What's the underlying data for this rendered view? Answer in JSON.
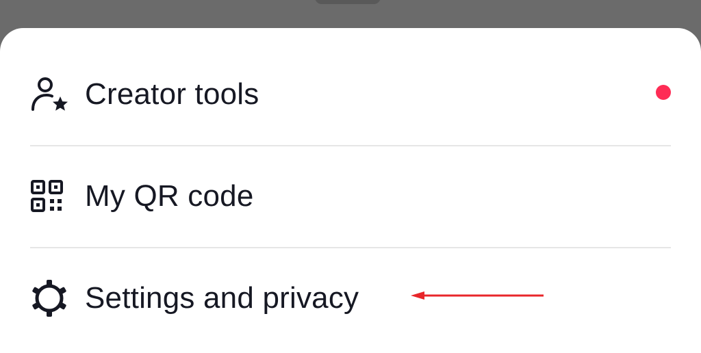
{
  "menu": {
    "items": [
      {
        "label": "Creator tools",
        "icon": "person-star-icon",
        "has_notification": true
      },
      {
        "label": "My QR code",
        "icon": "qr-code-icon"
      },
      {
        "label": "Settings and privacy",
        "icon": "gear-icon"
      }
    ]
  },
  "colors": {
    "notification_dot": "#fe2c55",
    "annotation_arrow": "#e8262a",
    "text": "#161823",
    "backdrop": "#6b6b6b"
  }
}
